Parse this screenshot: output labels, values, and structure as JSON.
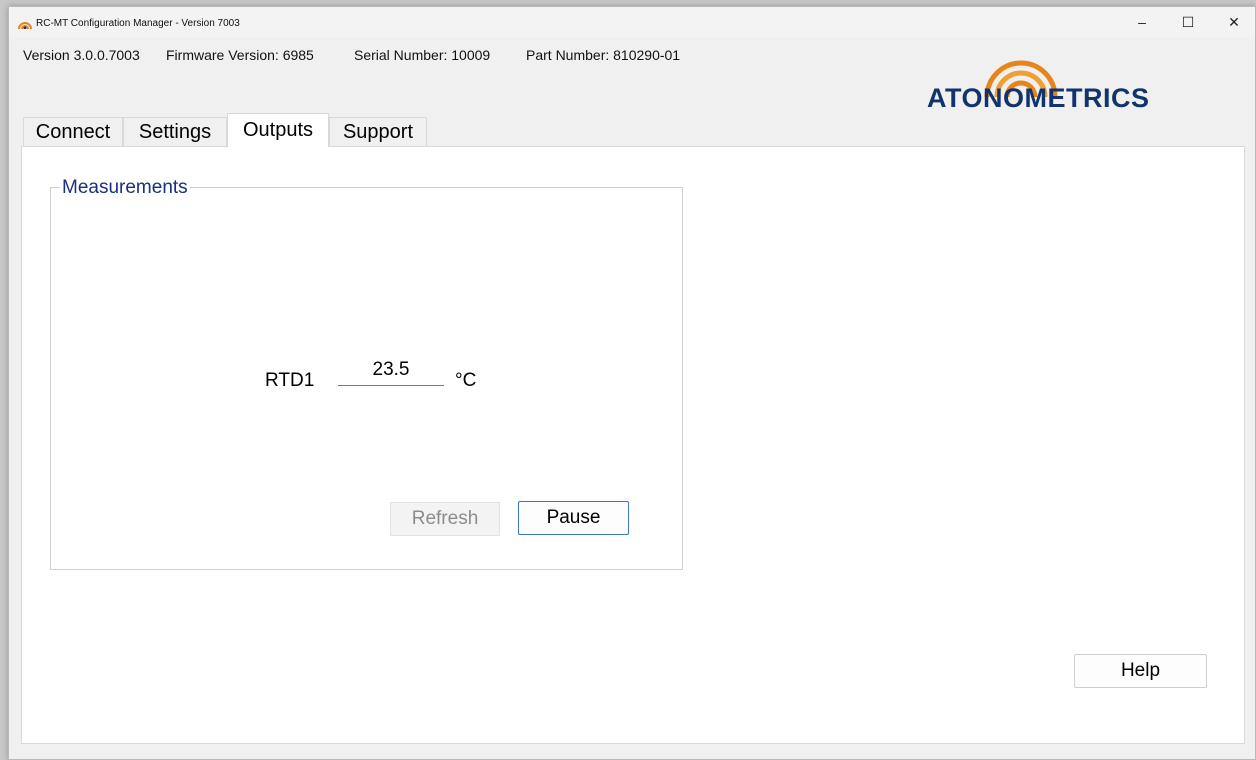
{
  "window": {
    "title": "RC-MT Configuration Manager - Version 7003",
    "controls": {
      "minimize": "–",
      "maximize": "☐",
      "close": "✕"
    }
  },
  "info": {
    "version": "Version 3.0.0.7003",
    "firmware": "Firmware Version: 6985",
    "serial": "Serial Number: 10009",
    "part": "Part Number: 810290-01"
  },
  "logo": {
    "text": "ATONOMETRICS",
    "color": "#12346c",
    "arc_color": "#e8841a"
  },
  "tabs": [
    {
      "label": "Connect",
      "active": false
    },
    {
      "label": "Settings",
      "active": false
    },
    {
      "label": "Outputs",
      "active": true
    },
    {
      "label": "Support",
      "active": false
    }
  ],
  "measurements": {
    "title": "Measurements",
    "rtd_label": "RTD1",
    "rtd_value": "23.5",
    "rtd_unit": "°C",
    "refresh_label": "Refresh",
    "pause_label": "Pause"
  },
  "help_label": "Help"
}
